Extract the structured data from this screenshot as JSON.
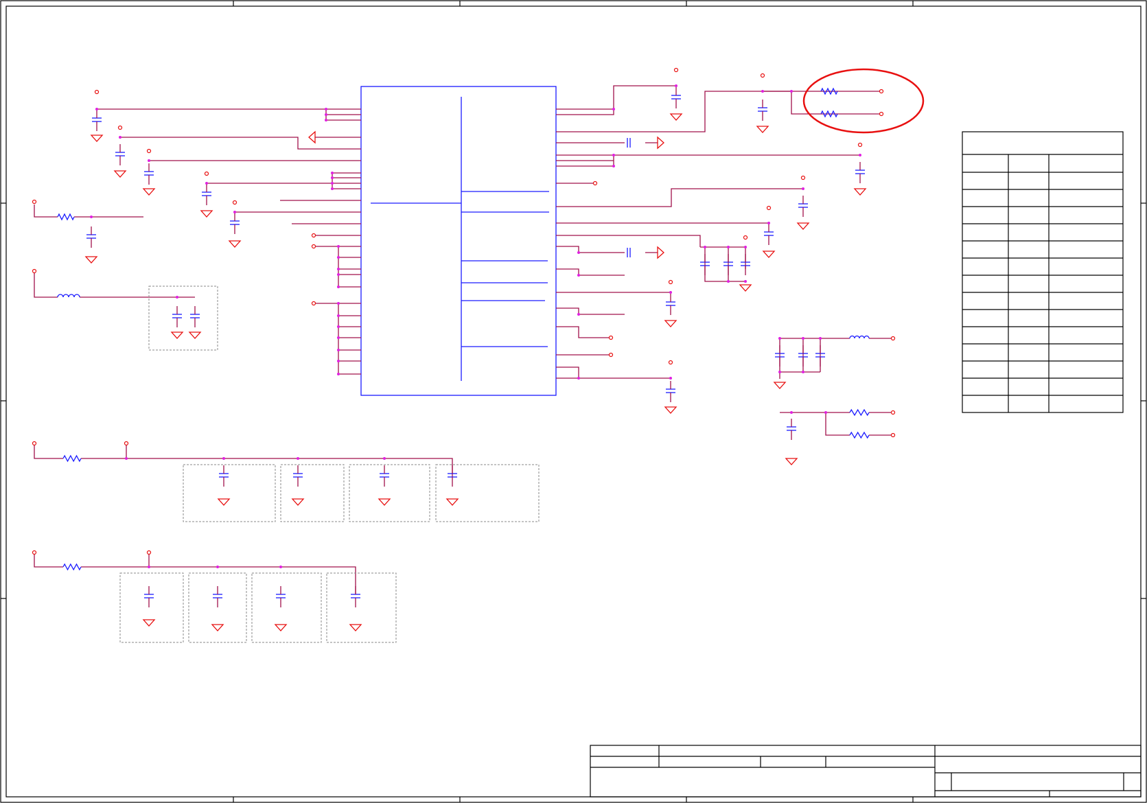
{
  "sheet": {
    "title": "",
    "revision": "",
    "size": "",
    "date": "",
    "sheet_number": ""
  },
  "ic": {
    "reference": "",
    "part": ""
  },
  "pin_table": {
    "header": "",
    "columns": [
      "",
      "",
      ""
    ],
    "rows": [
      [
        "",
        "",
        ""
      ],
      [
        "",
        "",
        ""
      ],
      [
        "",
        "",
        ""
      ],
      [
        "",
        "",
        ""
      ],
      [
        "",
        "",
        ""
      ],
      [
        "",
        "",
        ""
      ],
      [
        "",
        "",
        ""
      ],
      [
        "",
        "",
        ""
      ],
      [
        "",
        "",
        ""
      ],
      [
        "",
        "",
        ""
      ],
      [
        "",
        "",
        ""
      ],
      [
        "",
        "",
        ""
      ],
      [
        "",
        "",
        ""
      ],
      [
        "",
        "",
        ""
      ]
    ]
  },
  "highlight": {
    "color": "#e81010",
    "note": ""
  },
  "colors": {
    "wire": "#a0104a",
    "component": "#1a1aff",
    "power_ground": "#e81010",
    "junction": "#e020e0",
    "frame": "#000000"
  }
}
